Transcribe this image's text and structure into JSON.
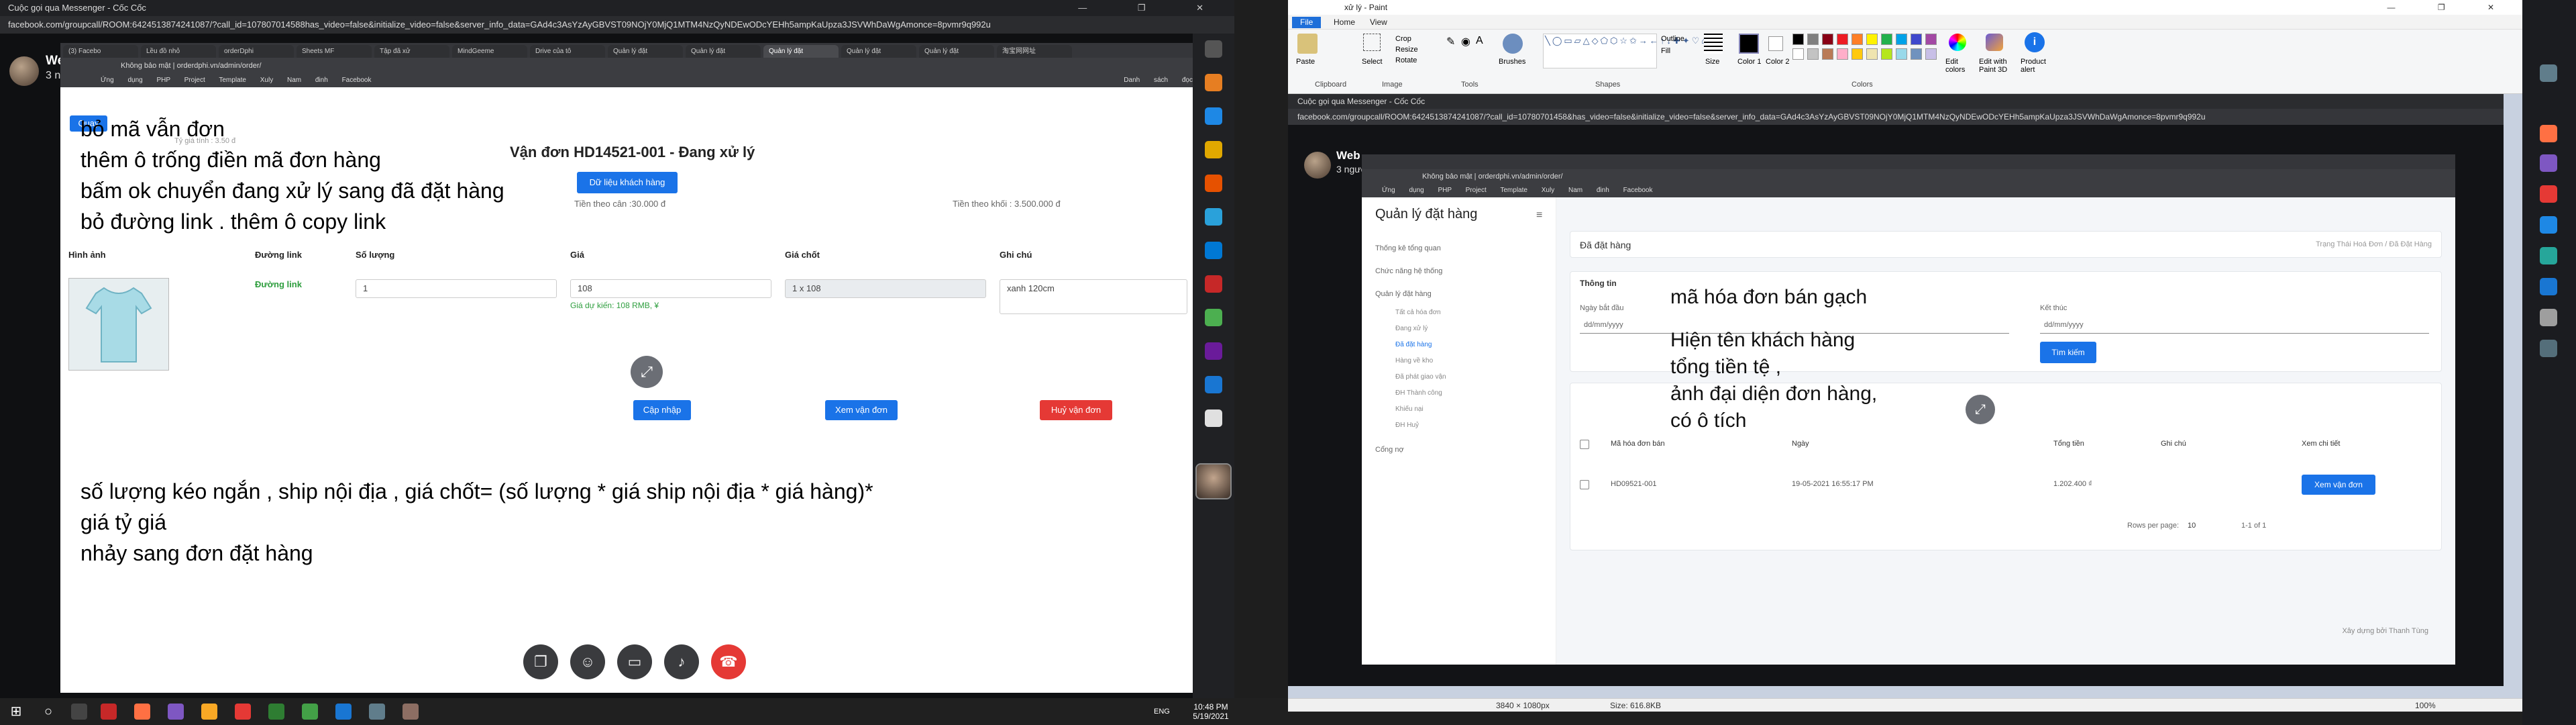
{
  "left_window": {
    "title": "Cuộc gọi qua Messenger - Cốc Cốc",
    "url": "facebook.com/groupcall/ROOM:6424513874241087/?call_id=107807014588has_video=false&initialize_video=false&server_info_data=GAd4c3AsYzAyGBVST09NOjY0MjQ1MTM4NzQyNDEwODcYEHh5ampKaUpza3JSVWhDaWgAmonce=8pvmr9q992u",
    "caller_name": "Web",
    "caller_count": "3 người",
    "tabs": [
      "(3) Facebo",
      "Lều đồ nhỏ",
      "orderDphi",
      "Sheets MF",
      "Tập đã xử",
      "MindGeeme",
      "Drive của tô",
      "Quản lý đặt",
      "Quản lý đặt",
      "Quản lý đặt",
      "Quản lý đặt",
      "Quản lý đặt",
      "淘宝网网址"
    ],
    "address": "Không bảo mật | orderdphi.vn/admin/order/",
    "bookmarks": [
      "Ứng dụng",
      "PHP Project",
      "Template",
      "Xuly",
      "Nam đinh",
      "Facebook",
      "Danh sách đọc"
    ],
    "window_controls": "— ❐ ✕",
    "shared_page": {
      "back_button": "Quay",
      "order_title": "Vận đơn HD14521-001 - Đang xử lý",
      "customer_button": "Dữ liệu khách hàng",
      "fee_left": "Tiền theo cân :30.000 đ",
      "fee_right": "Tiền theo khối : 3.500.000 đ",
      "rate_small": "Tỷ giá tính : 3.50 đ",
      "columns": [
        "Hình ảnh",
        "Đường link",
        "Số lượng",
        "Giá",
        "Giá chốt",
        "Ghi chú"
      ],
      "row": {
        "link": "Đường link",
        "quantity": "1",
        "price": "108",
        "price_hint": "Giá dự kiến: 108 RMB, ¥",
        "final_price": "1 x 108",
        "note": "xanh 120cm"
      },
      "buttons": {
        "update": "Cập nhập",
        "view": "Xem vận đơn",
        "cancel": "Huỷ vận đơn"
      }
    },
    "notes_top": [
      "bỏ mã vẫn đơn",
      "thêm ô trống điền mã đơn hàng",
      "bấm ok chuyển đang xử lý sang đã đặt hàng",
      "bỏ đường link . thêm ô copy link"
    ],
    "notes_bottom": [
      "số lượng kéo ngắn , ship nội địa , giá chốt= (số lượng * giá  ship nội địa  * giá hàng)*",
      "giá tỷ giá",
      "nhảy sang đơn đặt hàng"
    ]
  },
  "paint": {
    "title": "xử lý - Paint",
    "menus": [
      "File",
      "Home",
      "View"
    ],
    "ribbon_groups": [
      "Clipboard",
      "Image",
      "Tools",
      "Shapes",
      "Colors"
    ],
    "ribbon_labels": {
      "paste": "Paste",
      "select": "Select",
      "crop": "Crop",
      "resize": "Resize",
      "rotate": "Rotate",
      "brushes": "Brushes",
      "outline": "Outline",
      "fill": "Fill",
      "size": "Size",
      "color1": "Color 1",
      "color2": "Color 2",
      "edit_colors": "Edit colors",
      "edit_paint3d": "Edit with Paint 3D",
      "product_alert": "Product alert"
    },
    "palette": [
      "#000000",
      "#7f7f7f",
      "#880015",
      "#ed1c24",
      "#ff7f27",
      "#fff200",
      "#22b14c",
      "#00a2e8",
      "#3f48cc",
      "#a349a4",
      "#ffffff",
      "#c3c3c3",
      "#b97a57",
      "#ffaec9",
      "#ffc90e",
      "#efe4b0",
      "#b5e61d",
      "#99d9ea",
      "#7092be",
      "#c8bfe7"
    ],
    "status": {
      "dimensions": "3840 × 1080px",
      "size": "Size: 616.8KB",
      "zoom": "100%"
    },
    "inner": {
      "title": "Cuộc gọi qua Messenger - Cốc Cốc",
      "url": "facebook.com/groupcall/ROOM:6424513874241087/?call_id=10780701458&has_video=false&initialize_video=false&server_info_data=GAd4c3AsYzAyGBVST09NOjY0MjQ1MTM4NzQyNDEwODcYEHh5ampKaUpza3JSVWhDaWgAmonce=8pvmr9q992u",
      "caller_name": "Web",
      "caller_count": "3 người",
      "address": "Không bảo mật | orderdphi.vn/admin/order/",
      "bookmarks": [
        "Ứng dụng",
        "PHP Project",
        "Template",
        "Xuly",
        "Nam đinh",
        "Facebook"
      ],
      "admin": {
        "brand": "Quản lý đặt hàng",
        "menu": [
          "Thống kê tổng quan",
          "Chức năng hệ thống",
          "Quản lý đặt hàng",
          "Cổng nợ"
        ],
        "submenu": [
          "Tất cả hóa đơn",
          "Đang xử lý",
          "Đã đặt hàng",
          "Hàng về kho",
          "Đã phát giao vận",
          "ĐH Thành công",
          "Khiếu nại",
          "ĐH Huỷ"
        ],
        "breadcrumb_title": "Đã đặt hàng",
        "breadcrumb_path": "Trạng Thái Hoá Đơn / Đã Đặt Hàng",
        "info_title": "Thông tin",
        "start_label": "Ngày bắt đầu",
        "end_label": "Kết thúc",
        "date_placeholder": "dd/mm/yyyy",
        "search_button": "Tìm kiếm",
        "columns": [
          "Mã hóa đơn bán",
          "Ngày",
          "Tổng tiền",
          "Ghi chú",
          "Xem chi tiết"
        ],
        "row": {
          "code": "HD09521-001",
          "date": "19-05-2021 16:55:17 PM",
          "total": "1.202.400 ₫",
          "note": "",
          "view": "Xem vận đơn"
        },
        "rows_per_page_label": "Rows per page:",
        "rows_per_page": "10",
        "range": "1-1 of 1",
        "footer": "Xây dựng bởi Thanh Tùng"
      }
    },
    "notes": [
      "mã hóa đơn bán gạch",
      "Hiện tên khách hàng",
      "tổng tiền tệ ,",
      "ảnh đại diện đơn hàng,",
      "có ô tích"
    ]
  },
  "taskbar": {
    "clock_time": "10:48 PM",
    "clock_date": "5/19/2021",
    "lang": "ENG"
  },
  "colors": {
    "primary": "#1a73e8",
    "danger": "#e53935",
    "paint_file": "#1e6fd9"
  }
}
